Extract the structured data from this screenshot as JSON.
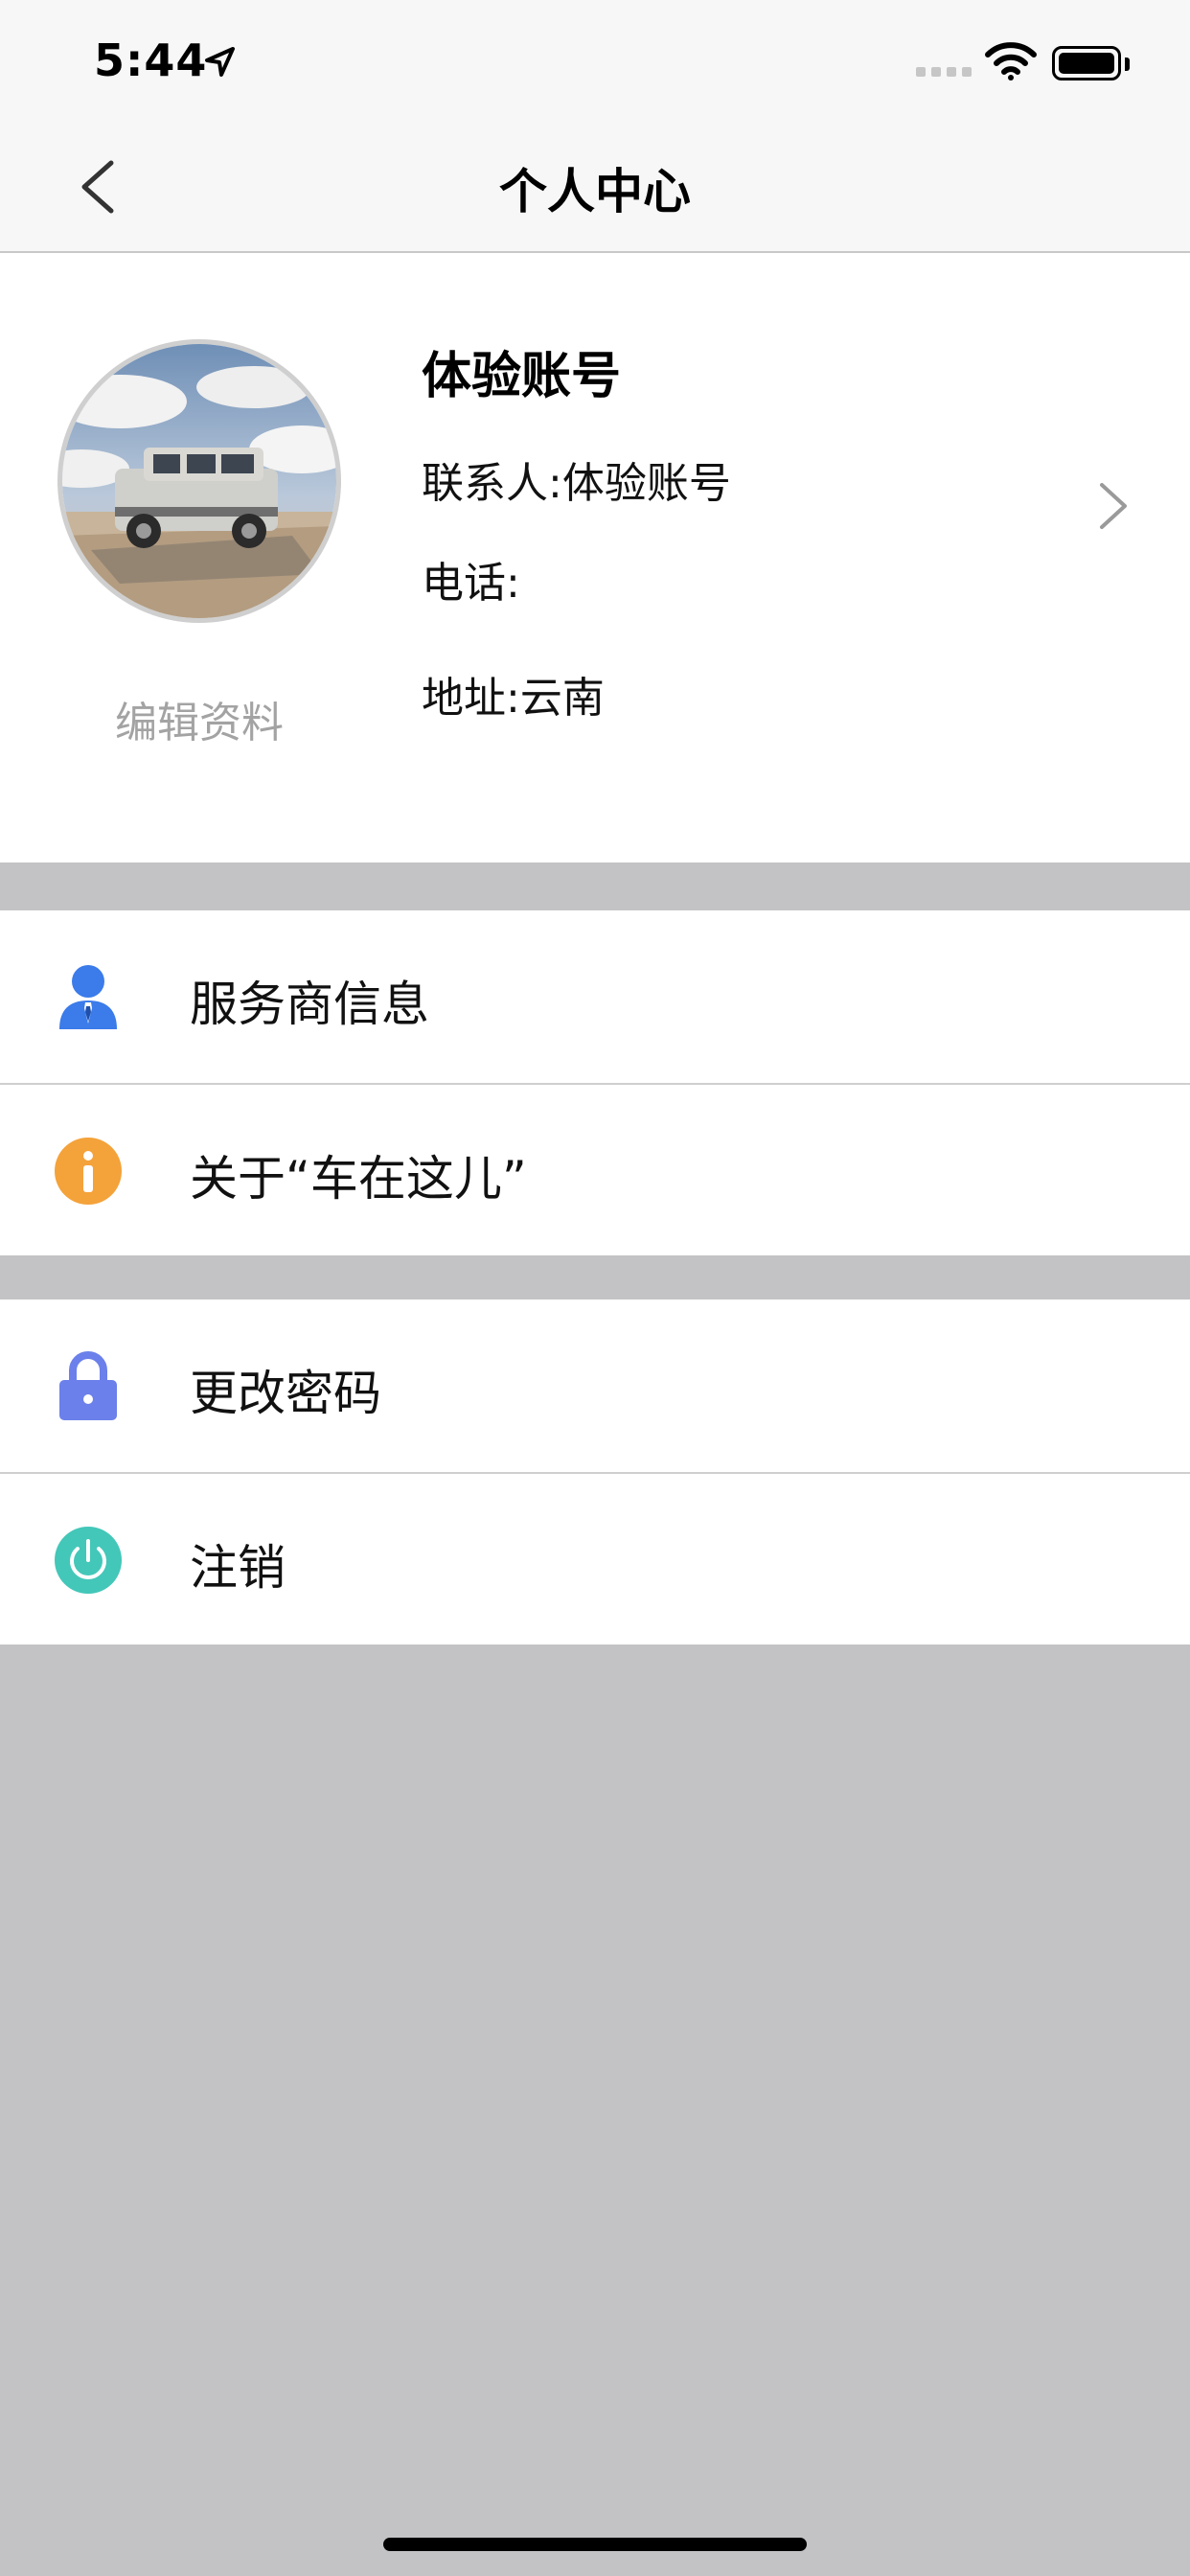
{
  "status_bar": {
    "time": "5:44"
  },
  "nav": {
    "title": "个人中心"
  },
  "profile": {
    "name": "体验账号",
    "contact": "联系人:体验账号",
    "phone": "电话:",
    "address": "地址:云南",
    "edit_label": "编辑资料"
  },
  "menu": {
    "group1": [
      {
        "label": "服务商信息",
        "icon": "person-icon",
        "color": "#3b7bea"
      },
      {
        "label": "关于“车在这儿”",
        "icon": "info-icon",
        "color": "#f4a23a"
      }
    ],
    "group2": [
      {
        "label": "更改密码",
        "icon": "lock-icon",
        "color": "#6b80ea"
      },
      {
        "label": "注销",
        "icon": "power-icon",
        "color": "#43c7b9"
      }
    ]
  },
  "colors": {
    "page_background": "#c3c3c5",
    "edit_label": "#a3a3a3"
  }
}
